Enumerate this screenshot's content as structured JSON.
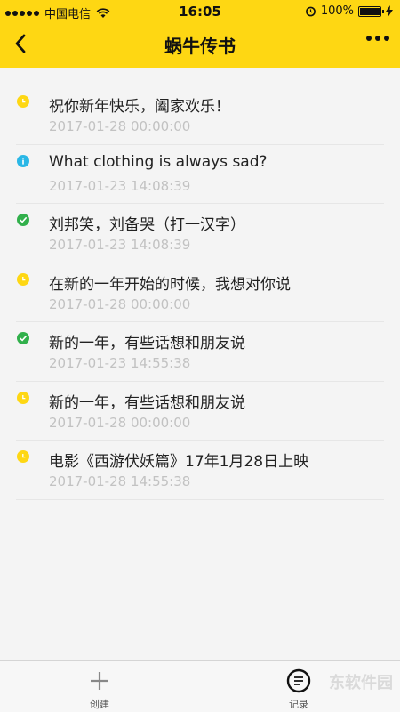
{
  "status_bar": {
    "carrier": "中国电信",
    "time": "16:05",
    "battery": "100%"
  },
  "nav": {
    "title": "蜗牛传书",
    "back_icon": "chevron-left-icon",
    "more_icon": "more-dots-icon"
  },
  "items": [
    {
      "title": "祝你新年快乐，阖家欢乐！",
      "date": "2017-01-28 00:00:00",
      "status": "clock",
      "color": "#fed713"
    },
    {
      "title": "What clothing is always sad?",
      "date": "2017-01-23 14:08:39",
      "status": "info",
      "color": "#2ab7e6"
    },
    {
      "title": "刘邦笑，刘备哭（打一汉字）",
      "date": "2017-01-23 14:08:39",
      "status": "check",
      "color": "#31b04b"
    },
    {
      "title": "在新的一年开始的时候，我想对你说",
      "date": "2017-01-28 00:00:00",
      "status": "clock",
      "color": "#fed713"
    },
    {
      "title": "新的一年，有些话想和朋友说",
      "date": "2017-01-23 14:55:38",
      "status": "check",
      "color": "#31b04b"
    },
    {
      "title": "新的一年，有些话想和朋友说",
      "date": "2017-01-28 00:00:00",
      "status": "clock",
      "color": "#fed713"
    },
    {
      "title": "电影《西游伏妖篇》17年1月28日上映",
      "date": "2017-01-28 14:55:38",
      "status": "clock",
      "color": "#fed713"
    }
  ],
  "tabbar": {
    "create_label": "创建",
    "record_label": "记录"
  },
  "watermark": "东软件园"
}
